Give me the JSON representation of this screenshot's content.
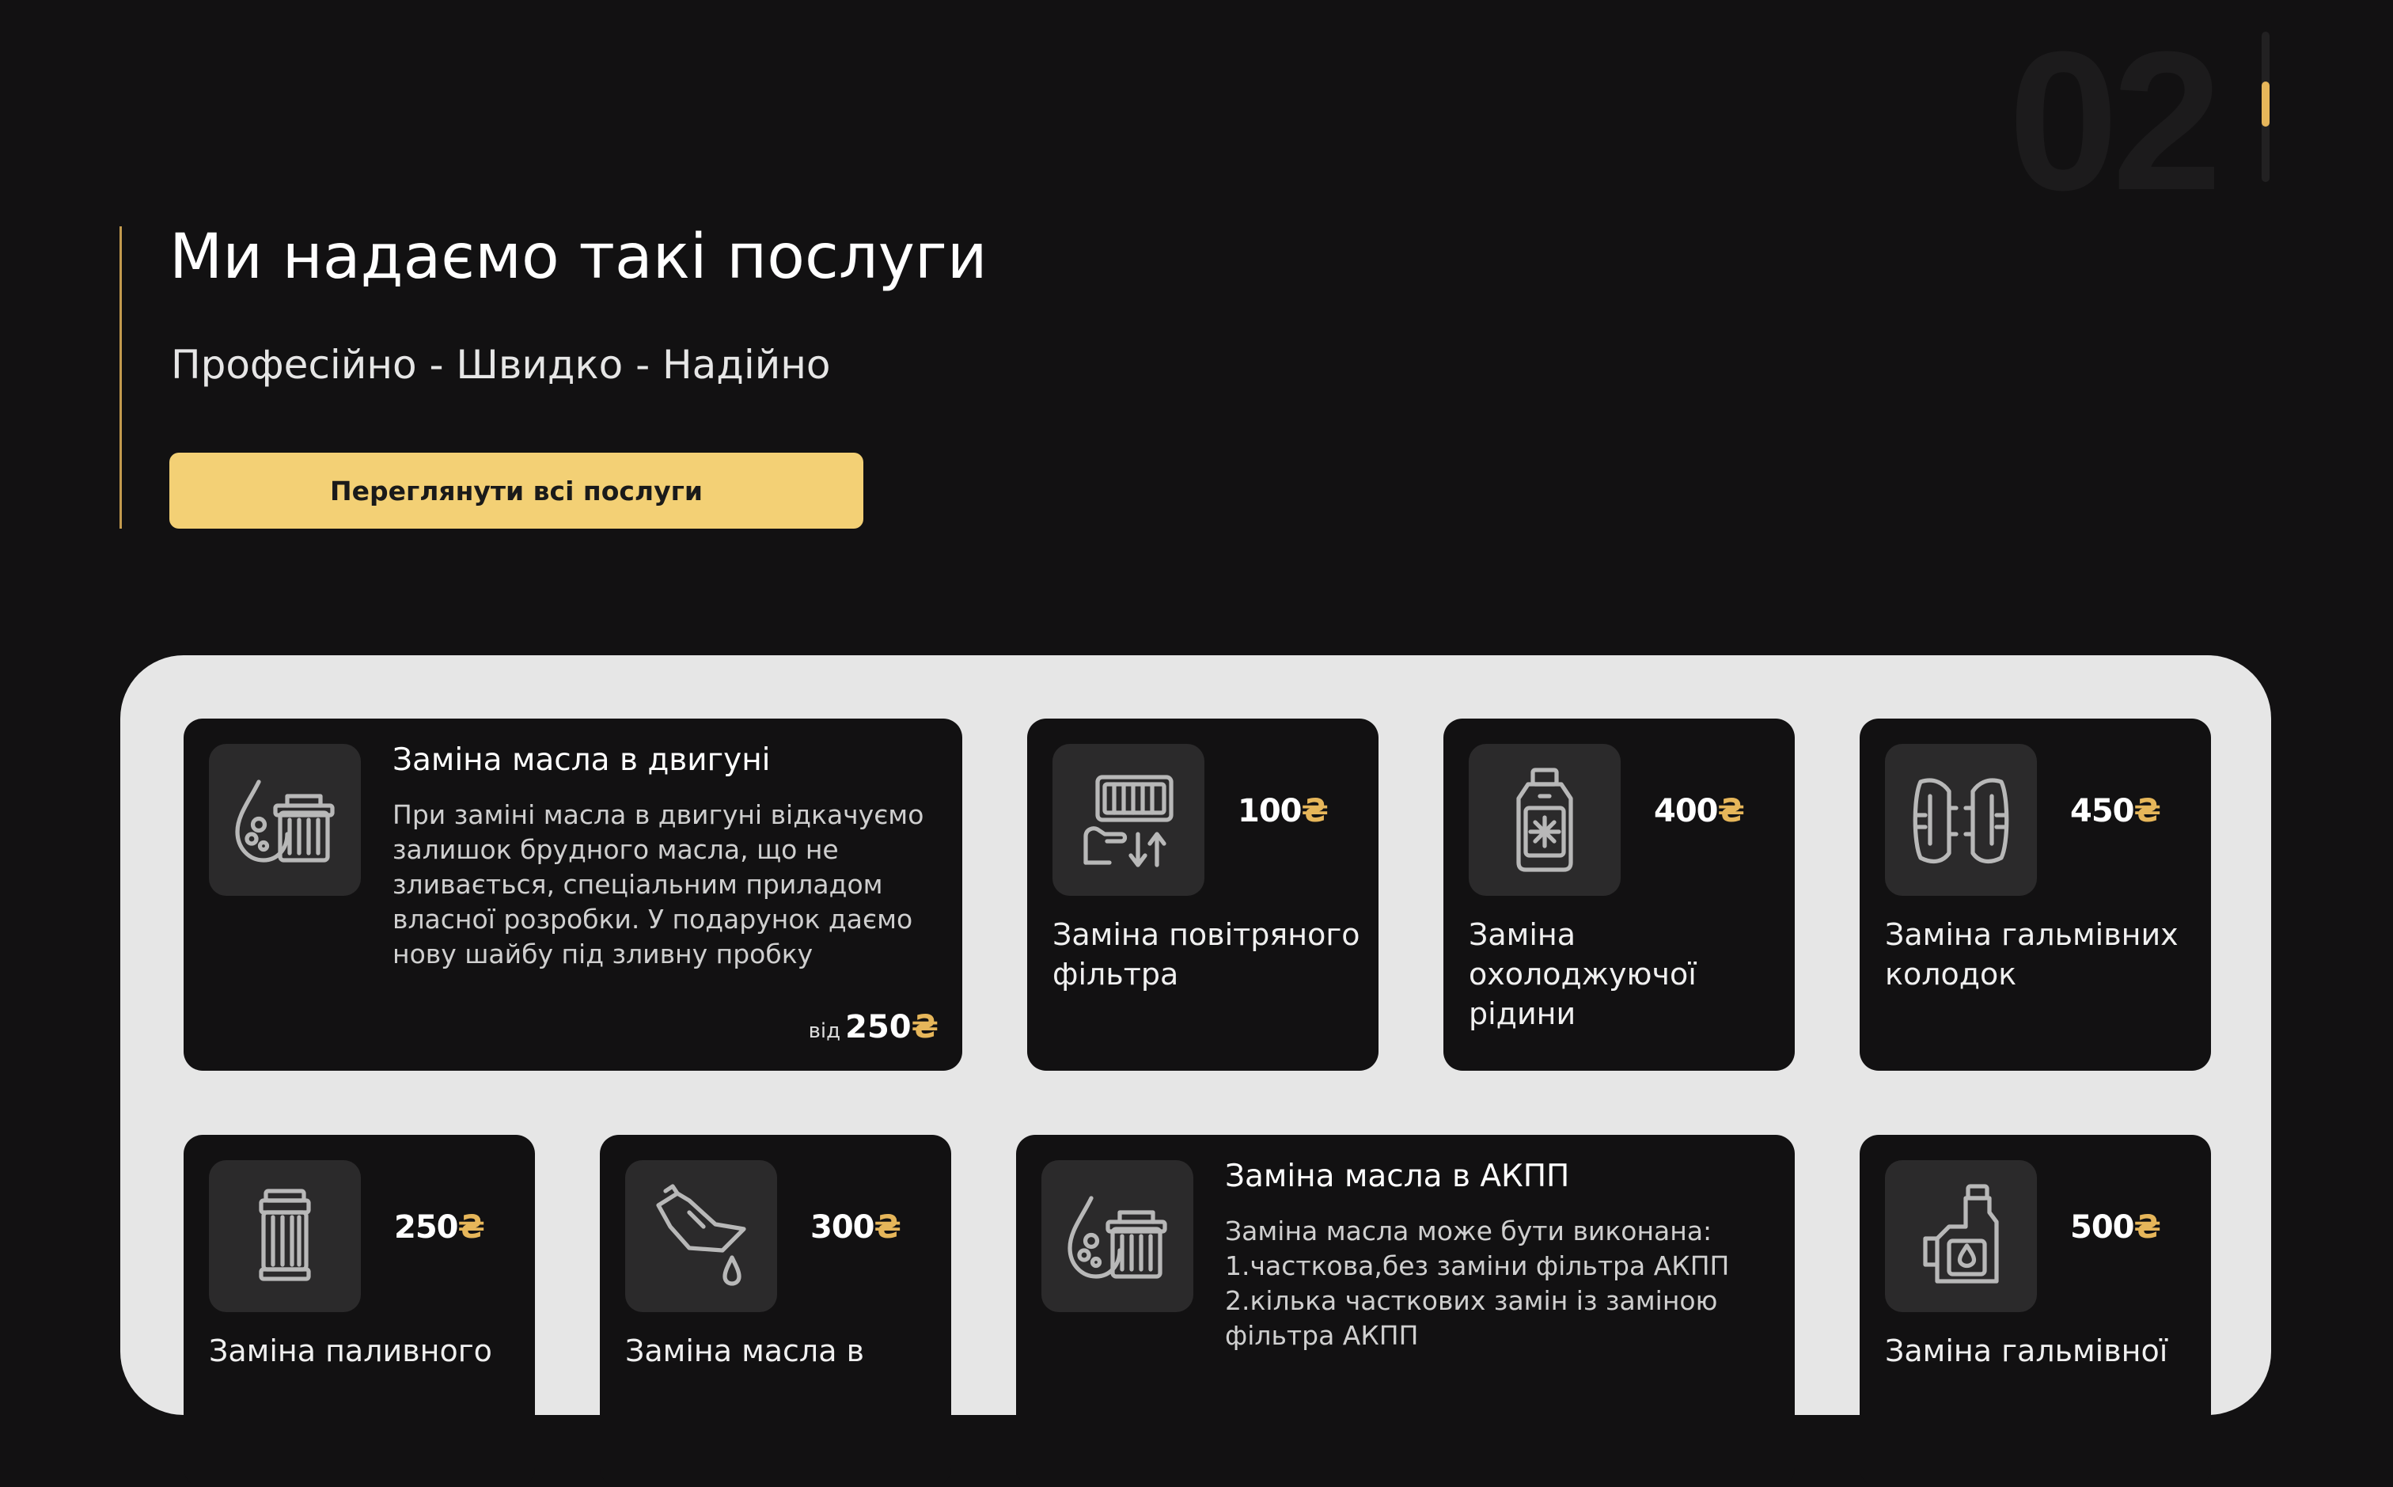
{
  "page_indicator": {
    "number": "02",
    "progress": 0.33
  },
  "hero": {
    "title": "Ми надаємо такі послуги",
    "subtitle": "Професійно - Швидко - Надійно",
    "cta_label": "Переглянути всі послуги"
  },
  "currency_symbol": "₴",
  "services": [
    {
      "title": "Заміна масла в двигуні",
      "description": "При заміні масла в двигуні відкачуємо залишок брудного масла, що не зливається, спеціальним приладом власної розробки. У подарунок даємо нову шайбу під зливну пробку",
      "from_label": "від",
      "price": "250",
      "icon": "oil-drop-filter-icon"
    },
    {
      "title": "Заміна повітряного фільтра",
      "price": "100",
      "icon": "air-filter-icon"
    },
    {
      "title": "Заміна охолоджуючої рідини",
      "price": "400",
      "icon": "coolant-bottle-icon"
    },
    {
      "title": "Заміна гальмівних колодок",
      "price": "450",
      "icon": "brake-pads-icon"
    },
    {
      "title": "Заміна паливного",
      "price": "250",
      "icon": "fuel-filter-icon"
    },
    {
      "title": "Заміна масла в",
      "price": "300",
      "icon": "oil-can-icon"
    },
    {
      "title": "Заміна масла в АКПП",
      "description": "Заміна масла може бути виконана: 1.часткова,без заміни фільтра АКПП 2.кілька часткових замін із заміною фільтра АКПП",
      "icon": "oil-drop-filter-icon"
    },
    {
      "title": "Заміна гальмівної",
      "price": "500",
      "icon": "brake-fluid-bottle-icon"
    }
  ],
  "colors": {
    "background": "#121112",
    "accent": "#f3d075",
    "currency": "#e6b65a",
    "panel": "#e6e6e6",
    "card": "#121112",
    "icon_tile": "#2b2a2b"
  }
}
